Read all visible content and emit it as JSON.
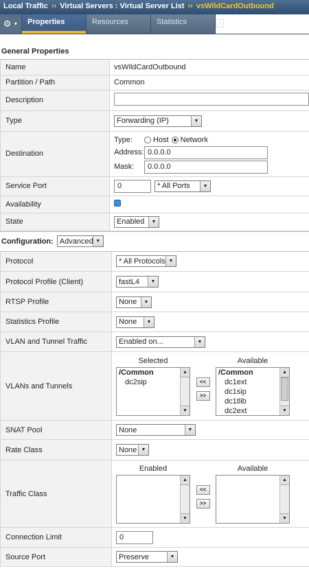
{
  "breadcrumb": {
    "items": [
      "Local Traffic",
      "Virtual Servers : Virtual Server List",
      "vsWildCardOutbound"
    ],
    "separator": "››"
  },
  "tabs": [
    {
      "label": "Properties",
      "active": true
    },
    {
      "label": "Resources",
      "active": false
    },
    {
      "label": "Statistics",
      "active": false
    }
  ],
  "general": {
    "title": "General Properties",
    "name_label": "Name",
    "name_value": "vsWildCardOutbound",
    "partition_label": "Partition / Path",
    "partition_value": "Common",
    "description_label": "Description",
    "description_value": "",
    "type_label": "Type",
    "type_value": "Forwarding (IP)",
    "destination_label": "Destination",
    "dest_type_label": "Type:",
    "dest_host_label": "Host",
    "dest_network_label": "Network",
    "dest_address_label": "Address:",
    "dest_address_value": "0.0.0.0",
    "dest_mask_label": "Mask:",
    "dest_mask_value": "0.0.0.0",
    "service_port_label": "Service Port",
    "service_port_value": "0",
    "service_port_select": "* All Ports",
    "availability_label": "Availability",
    "state_label": "State",
    "state_value": "Enabled"
  },
  "config": {
    "title": "Configuration:",
    "mode": "Advanced",
    "protocol_label": "Protocol",
    "protocol_value": "* All Protocols",
    "profile_client_label": "Protocol Profile (Client)",
    "profile_client_value": "fastL4",
    "rtsp_label": "RTSP Profile",
    "rtsp_value": "None",
    "stats_label": "Statistics Profile",
    "stats_value": "None",
    "vlan_traffic_label": "VLAN and Tunnel Traffic",
    "vlan_traffic_value": "Enabled on...",
    "vlans_label": "VLANs and Tunnels",
    "vlans_selected_header": "Selected",
    "vlans_available_header": "Available",
    "vlans_selected_group": "/Common",
    "vlans_selected": [
      "dc2sip"
    ],
    "vlans_available_group": "/Common",
    "vlans_available": [
      "dc1ext",
      "dc1sip",
      "dc1tlib",
      "dc2ext"
    ],
    "move_left": "<<",
    "move_right": ">>",
    "snat_label": "SNAT Pool",
    "snat_value": "None",
    "rate_label": "Rate Class",
    "rate_value": "None",
    "traffic_label": "Traffic Class",
    "traffic_enabled_header": "Enabled",
    "traffic_available_header": "Available",
    "conn_limit_label": "Connection Limit",
    "conn_limit_value": "0",
    "source_port_label": "Source Port",
    "source_port_value": "Preserve"
  }
}
